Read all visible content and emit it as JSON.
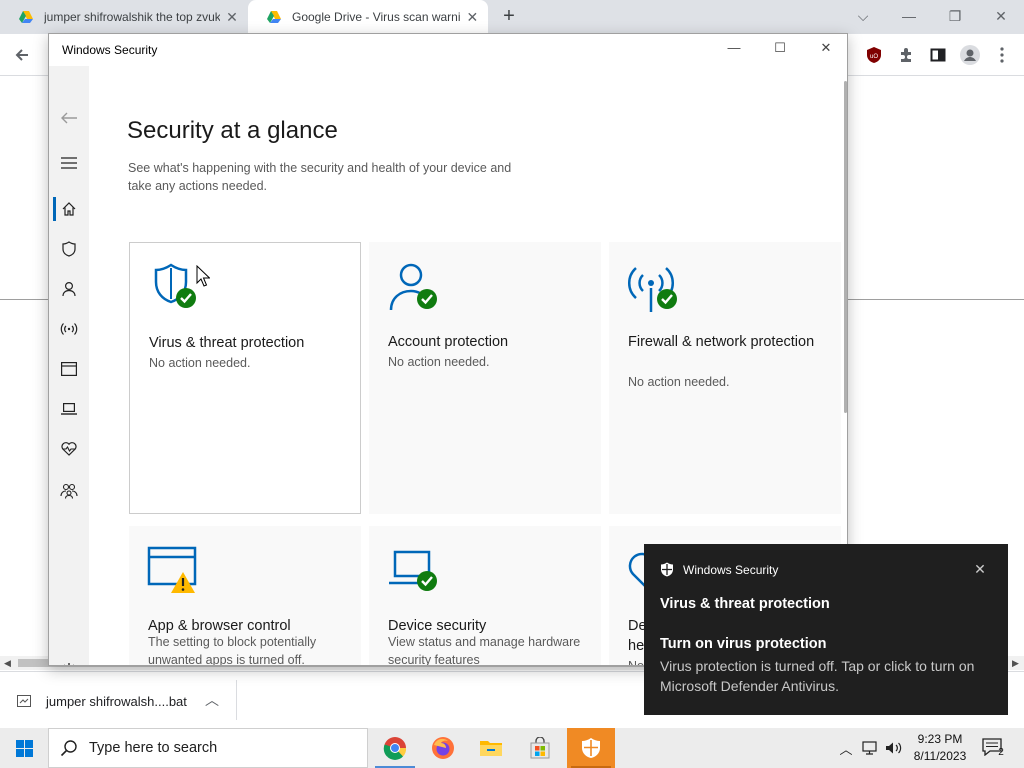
{
  "browser": {
    "tabs": [
      {
        "title": "jumper shifrowalshik the top zvuk",
        "active": false
      },
      {
        "title": "Google Drive - Virus scan warning",
        "active": true
      }
    ],
    "download": {
      "filename": "jumper shifrowalsh....bat"
    }
  },
  "window": {
    "title": "Windows Security"
  },
  "page": {
    "title": "Security at a glance",
    "description": "See what's happening with the security and health of your device and take any actions needed."
  },
  "nav": {
    "items": [
      "home",
      "virus-threat",
      "account",
      "firewall",
      "app-browser",
      "device-security",
      "device-health",
      "family"
    ]
  },
  "tiles": [
    {
      "name": "Virus & threat protection",
      "status": "No action needed.",
      "state": "ok"
    },
    {
      "name": "Account protection",
      "status": "No action needed.",
      "state": "ok"
    },
    {
      "name": "Firewall & network protection",
      "status": "No action needed.",
      "state": "ok"
    },
    {
      "name": "App & browser control",
      "status": "The setting to block potentially unwanted apps is turned off.",
      "state": "warning"
    },
    {
      "name": "Device security",
      "status": "View status and manage hardware security features",
      "state": "ok"
    },
    {
      "name": "De",
      "name2": "he",
      "status": "No",
      "state": "ok"
    }
  ],
  "toast": {
    "app": "Windows Security",
    "title": "Virus & threat protection",
    "subtitle": "Turn on virus protection",
    "body": "Virus protection is turned off. Tap or click to turn on Microsoft Defender Antivirus."
  },
  "taskbar": {
    "search_placeholder": "Type here to search",
    "time": "9:23 PM",
    "date": "8/11/2023",
    "notification_count": "2"
  },
  "colors": {
    "accent_blue": "#0067b8",
    "ok_green": "#107c10",
    "warning_yellow": "#ffb900",
    "toast_bg": "#1f1f1f"
  }
}
